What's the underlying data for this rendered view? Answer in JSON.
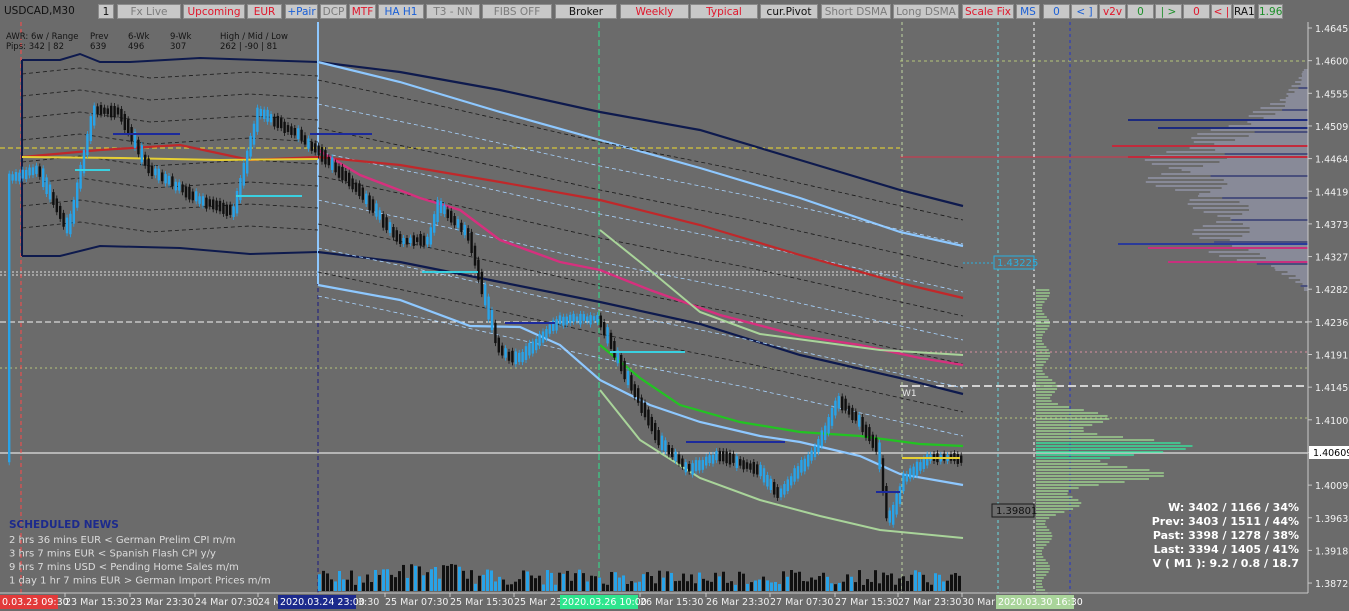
{
  "window": {
    "symbol": "USDCAD,M30"
  },
  "toolbar": [
    {
      "label": "1",
      "color": "black"
    },
    {
      "label": "Fx Live",
      "color": "gray"
    },
    {
      "label": "Upcoming",
      "color": "red"
    },
    {
      "label": "EUR",
      "color": "red"
    },
    {
      "label": "+Pair",
      "color": "blue"
    },
    {
      "label": "DCP",
      "color": "gray"
    },
    {
      "label": "MTF",
      "color": "red"
    },
    {
      "label": "HA H1",
      "color": "blue"
    },
    {
      "label": "T3 - NN",
      "color": "gray"
    },
    {
      "label": "FIBS OFF",
      "color": "gray"
    },
    {
      "label": "Broker",
      "color": "black"
    },
    {
      "label": "Weekly",
      "color": "red"
    },
    {
      "label": "Typical",
      "color": "red"
    },
    {
      "label": "cur.Pivot",
      "color": "black"
    },
    {
      "label": "Short DSMA",
      "color": "gray"
    },
    {
      "label": "Long DSMA",
      "color": "gray"
    },
    {
      "label": "Scale Fix",
      "color": "red"
    },
    {
      "label": "MS",
      "color": "blue"
    },
    {
      "label": "0",
      "color": "blue"
    },
    {
      "label": "< ]",
      "color": "blue"
    },
    {
      "label": "v2v",
      "color": "red"
    },
    {
      "label": "0",
      "color": "green"
    },
    {
      "label": "| >",
      "color": "green"
    },
    {
      "label": "0",
      "color": "red"
    },
    {
      "label": "< |",
      "color": "red"
    },
    {
      "label": "RA1",
      "color": "black"
    },
    {
      "label": "1.96",
      "color": "green"
    }
  ],
  "adr_panel": {
    "row1": [
      "AWR: 6w / Range",
      "Prev",
      "6-Wk",
      "9-Wk",
      "High / Mid / Low"
    ],
    "row2": [
      "Pips:  342 | 82",
      "639",
      "496",
      "307",
      "262  |  -90  |  81"
    ]
  },
  "news": {
    "title": "SCHEDULED NEWS",
    "items": [
      "2 hrs 36 mins  EUR  <  German Prelim CPI m/m",
      "3 hrs 7 mins  EUR  <  Spanish Flash CPI y/y",
      "9 hrs 7 mins  USD  <  Pending Home Sales m/m",
      "1 day 1 hr 7 mins  EUR  >  German Import Prices m/m"
    ]
  },
  "stats": [
    "W: 3402 / 1166 / 34%",
    "Prev: 3403 / 1511 / 44%",
    "Past: 3398 / 1278 / 38%",
    "Last: 3394 / 1405 / 41%",
    "V ( M1 ): 9.2 / 0.8 / 18.7"
  ],
  "price_axis": {
    "ticks": [
      "1.46456",
      "1.46006",
      "1.45556",
      "1.45091",
      "1.44641",
      "1.44191",
      "1.43736",
      "1.43276",
      "1.42826",
      "1.42361",
      "1.41911",
      "1.41456",
      "1.41006",
      "1.40556",
      "1.40096",
      "1.39636",
      "1.39186",
      "1.38726"
    ],
    "current_price": "1.40609"
  },
  "time_axis": {
    "labels": [
      "23 Mar 15:30",
      "23 Mar 23:30",
      "24 Mar 07:30",
      "24 M",
      "25 Mar 07:30",
      "25 Mar 15:30",
      "25 Mar 23:",
      "26 Mar 15:30",
      "26 Mar 23:30",
      "27 Mar 07:30",
      "27 Mar 15:30",
      "27 Mar 23:30",
      "30 Mar"
    ],
    "marker_left": "0.03.23 09:30",
    "marker_blue": "2020.03.24 23:00",
    "marker_blue_suffix": "3:30",
    "marker_green": "2020.03.26 10:00",
    "marker_right": "2020.03.30 16:30"
  },
  "price_labels": {
    "upper": "1.43225",
    "lower": "1.39801",
    "w1": "W1"
  },
  "colors": {
    "background": "#6b6b6b",
    "bull_candle": "#29a3e8",
    "bear_candle": "#101010",
    "red_ma": "#c0282a",
    "pink_ma": "#d6307e",
    "navy_band": "#0e1a4d",
    "light_band": "#8ec8ff",
    "green_ma": "#22c422",
    "sage_band": "#a9d49a"
  }
}
